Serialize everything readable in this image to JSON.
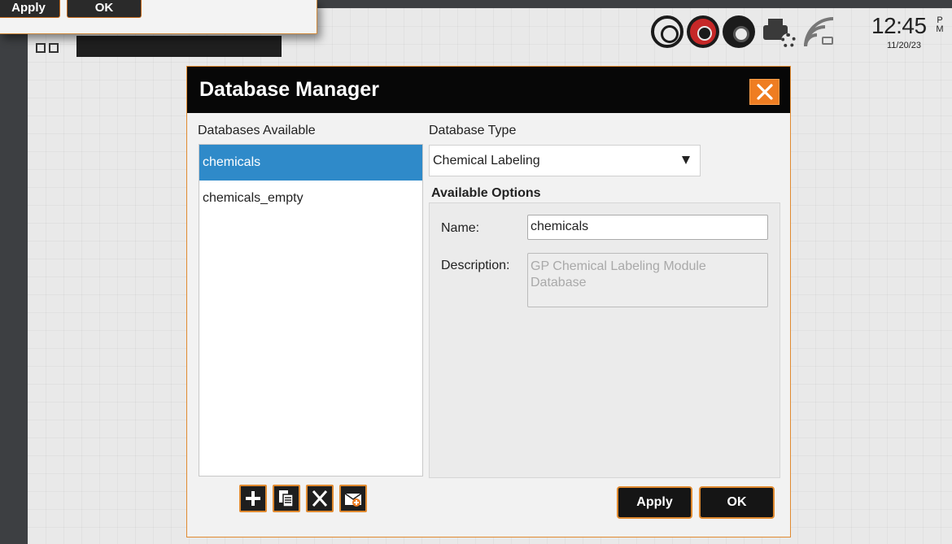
{
  "window": {
    "title": "Database Manager"
  },
  "status_bar": {
    "time": "12:45",
    "ampm_top": "P",
    "ampm_bottom": "M",
    "date": "11/20/23"
  },
  "background_popup": {
    "apply_label": "Apply",
    "ok_label": "OK"
  },
  "databases_panel": {
    "label": "Databases Available",
    "items": [
      {
        "label": "chemicals",
        "selected": true
      },
      {
        "label": "chemicals_empty",
        "selected": false
      }
    ]
  },
  "database_type": {
    "label": "Database Type",
    "selected_value": "Chemical Labeling"
  },
  "available_options": {
    "title": "Available Options",
    "name_label": "Name:",
    "name_value": "chemicals",
    "description_label": "Description:",
    "description_value": "GP Chemical Labeling Module Database"
  },
  "toolbar": {
    "icons": [
      "add-icon",
      "copy-icon",
      "delete-icon",
      "import-icon"
    ]
  },
  "buttons": {
    "apply_label": "Apply",
    "ok_label": "OK"
  },
  "colors": {
    "accent": "#ef7d22",
    "selection": "#2f8ac9",
    "title_bar": "#070707"
  }
}
